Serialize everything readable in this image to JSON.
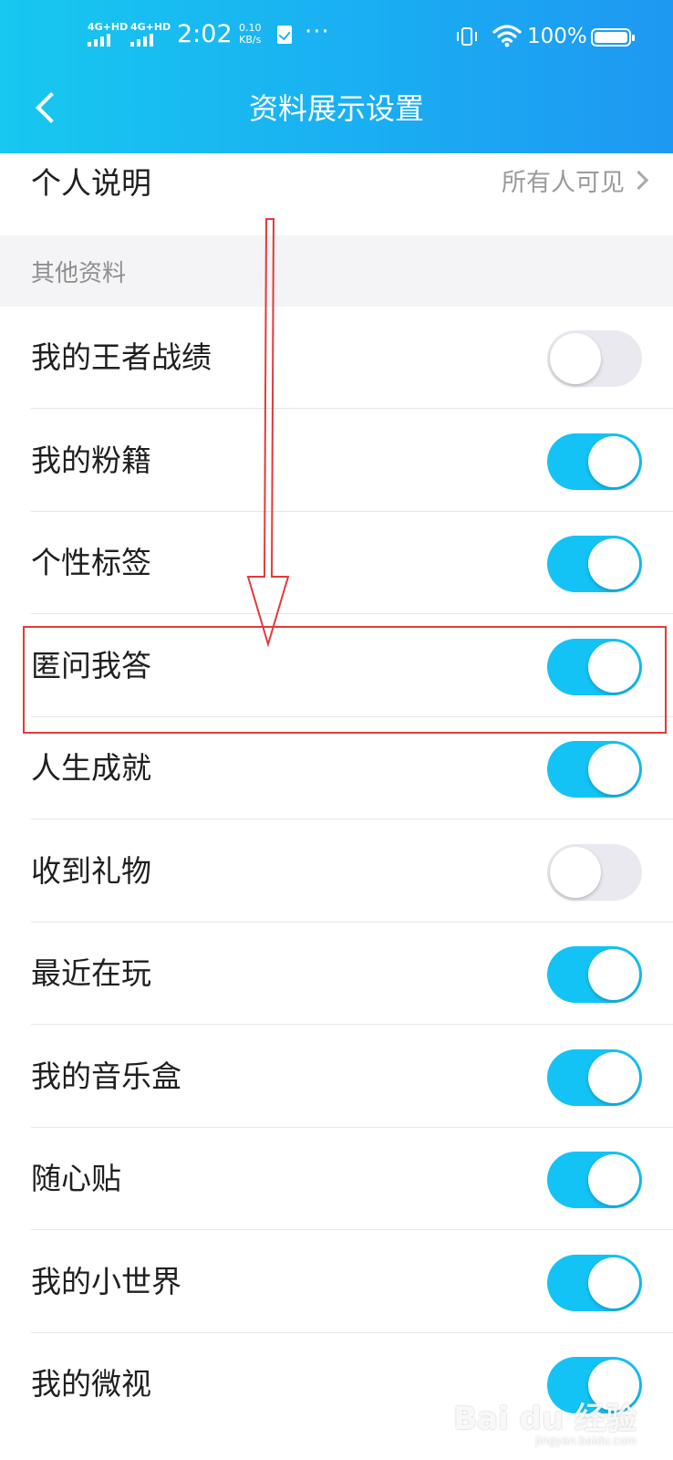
{
  "status_bar": {
    "net1": "4G+HD",
    "net2": "4G+HD",
    "time": "2:02",
    "speed_value": "0.10",
    "speed_unit": "KB/s",
    "more": "···",
    "battery_percent": "100%"
  },
  "header": {
    "title": "资料展示设置",
    "back_icon": "chevron-left-icon"
  },
  "personal_intro": {
    "label": "个人说明",
    "value": "所有人可见"
  },
  "section": {
    "title": "其他资料"
  },
  "items": [
    {
      "label": "我的王者战绩",
      "on": false
    },
    {
      "label": "我的粉籍",
      "on": true
    },
    {
      "label": "个性标签",
      "on": true
    },
    {
      "label": "匿问我答",
      "on": true
    },
    {
      "label": "人生成就",
      "on": true
    },
    {
      "label": "收到礼物",
      "on": false
    },
    {
      "label": "最近在玩",
      "on": true
    },
    {
      "label": "我的音乐盒",
      "on": true
    },
    {
      "label": "随心贴",
      "on": true
    },
    {
      "label": "我的小世界",
      "on": true
    },
    {
      "label": "我的微视",
      "on": true
    }
  ],
  "colors": {
    "header": "#1ab6f1",
    "toggle_on": "#14c3f5",
    "toggle_off": "#e9e9ef",
    "annotation": "#e23a3a"
  },
  "watermark": {
    "text": "Bai du 经验",
    "sub": "jingyan.baidu.com"
  }
}
